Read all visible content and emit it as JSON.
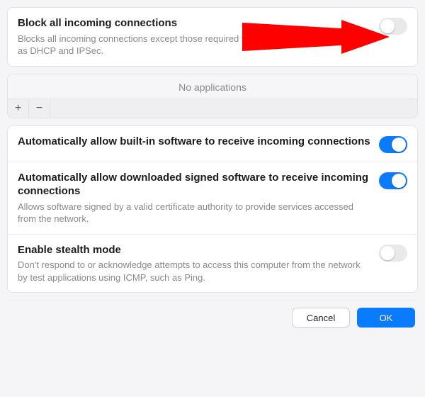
{
  "block_all": {
    "title": "Block all incoming connections",
    "desc": "Blocks all incoming connections except those required for basic internet services, such as DHCP and IPSec.",
    "enabled": false
  },
  "apps": {
    "empty_label": "No applications",
    "add_label": "+",
    "remove_label": "−"
  },
  "options": [
    {
      "title": "Automatically allow built-in software to receive incoming connections",
      "desc": "",
      "enabled": true
    },
    {
      "title": "Automatically allow downloaded signed software to receive incoming connections",
      "desc": "Allows software signed by a valid certificate authority to provide services accessed from the network.",
      "enabled": true
    },
    {
      "title": "Enable stealth mode",
      "desc": "Don't respond to or acknowledge attempts to access this computer from the network by test applications using ICMP, such as Ping.",
      "enabled": false
    }
  ],
  "buttons": {
    "cancel": "Cancel",
    "ok": "OK"
  },
  "colors": {
    "accent": "#0a7aff",
    "arrow": "#ff0000"
  }
}
